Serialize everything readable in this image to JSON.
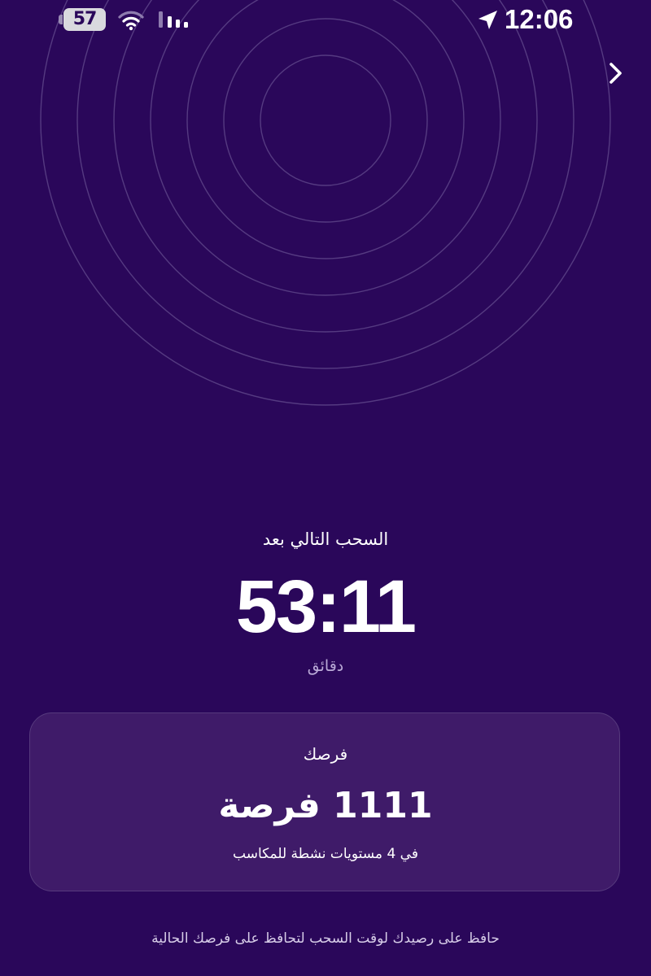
{
  "status_bar": {
    "battery_level": "57",
    "time": "12:06",
    "icons": [
      "battery-icon",
      "wifi-icon",
      "signal-icon",
      "location-arrow-icon"
    ]
  },
  "header": {
    "nav_icon": "chevron-right-icon"
  },
  "countdown": {
    "label": "السحب التالي بعد",
    "time": "53:11",
    "unit": "دقائق"
  },
  "chances_card": {
    "title": "فرصك",
    "count": "1111 فرصة",
    "subtitle": "في 4 مستويات نشطة للمكاسب"
  },
  "footer": {
    "note": "حافظ على رصيدك لوقت السحب لتحافظ على فرصك الحالية"
  },
  "colors": {
    "background": "#2a075a",
    "card": "#3f1b69",
    "ring": "#5d4488",
    "muted_text": "#b9a9d6"
  }
}
